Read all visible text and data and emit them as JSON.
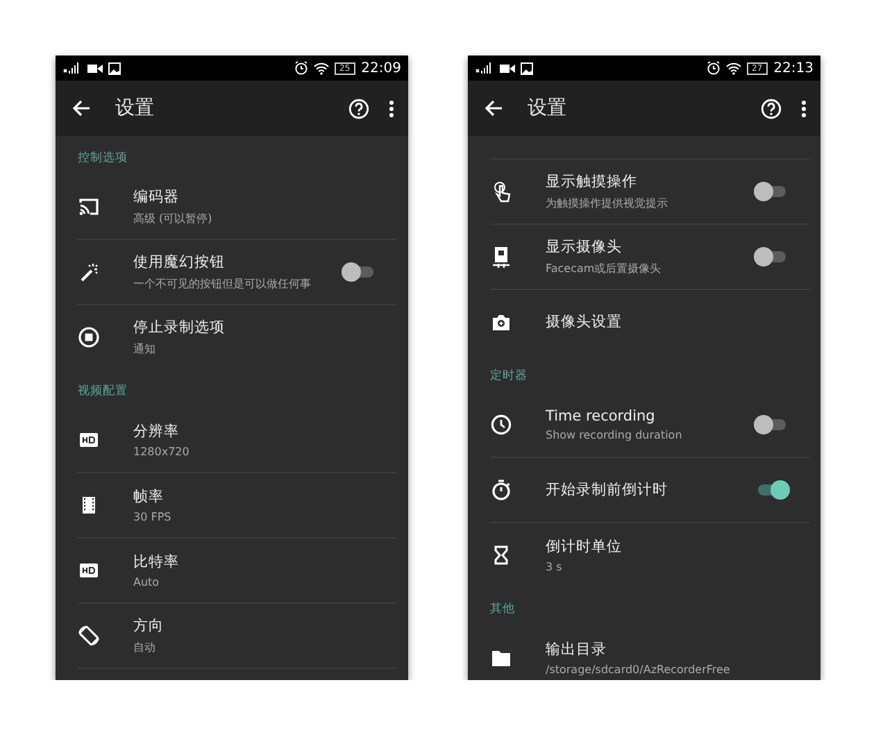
{
  "phones": [
    {
      "status_bar": {
        "battery": "25",
        "time": "22:09"
      },
      "app_bar": {
        "title": "设置"
      },
      "items": [
        {
          "kind": "section",
          "title": "控制选项"
        },
        {
          "kind": "setting",
          "title": "编码器",
          "subtitle": "高级 (可以暂停)"
        },
        {
          "kind": "setting",
          "title": "使用魔幻按钮",
          "subtitle": "一个不可见的按钮但是可以做任何事",
          "on": false
        },
        {
          "kind": "setting",
          "title": "停止录制选项",
          "subtitle": "通知"
        },
        {
          "kind": "section",
          "title": "视频配置"
        },
        {
          "kind": "setting",
          "title": "分辨率",
          "subtitle": "1280x720"
        },
        {
          "kind": "setting",
          "title": "帧率",
          "subtitle": "30 FPS"
        },
        {
          "kind": "setting",
          "title": "比特率",
          "subtitle": "Auto"
        },
        {
          "kind": "setting",
          "title": "方向",
          "subtitle": "自动"
        },
        {
          "kind": "cut-row"
        }
      ]
    },
    {
      "status_bar": {
        "battery": "27",
        "time": "22:13"
      },
      "app_bar": {
        "title": "设置"
      },
      "items": [
        {
          "kind": "cut-row"
        },
        {
          "kind": "setting",
          "title": "显示触摸操作",
          "subtitle": "为触摸操作提供视觉提示",
          "on": false
        },
        {
          "kind": "setting",
          "title": "显示摄像头",
          "subtitle": "Facecam或后置摄像头",
          "on": false
        },
        {
          "kind": "setting",
          "title": "摄像头设置"
        },
        {
          "kind": "section",
          "title": "定时器"
        },
        {
          "kind": "setting",
          "title": "Time recording",
          "subtitle": "Show recording duration",
          "on": false
        },
        {
          "kind": "setting",
          "title": "开始录制前倒计时",
          "on": true
        },
        {
          "kind": "setting",
          "title": "倒计时单位",
          "subtitle": "3 s"
        },
        {
          "kind": "section",
          "title": "其他"
        },
        {
          "kind": "setting",
          "title": "输出目录",
          "subtitle": "/storage/sdcard0/AzRecorderFree"
        }
      ]
    }
  ]
}
